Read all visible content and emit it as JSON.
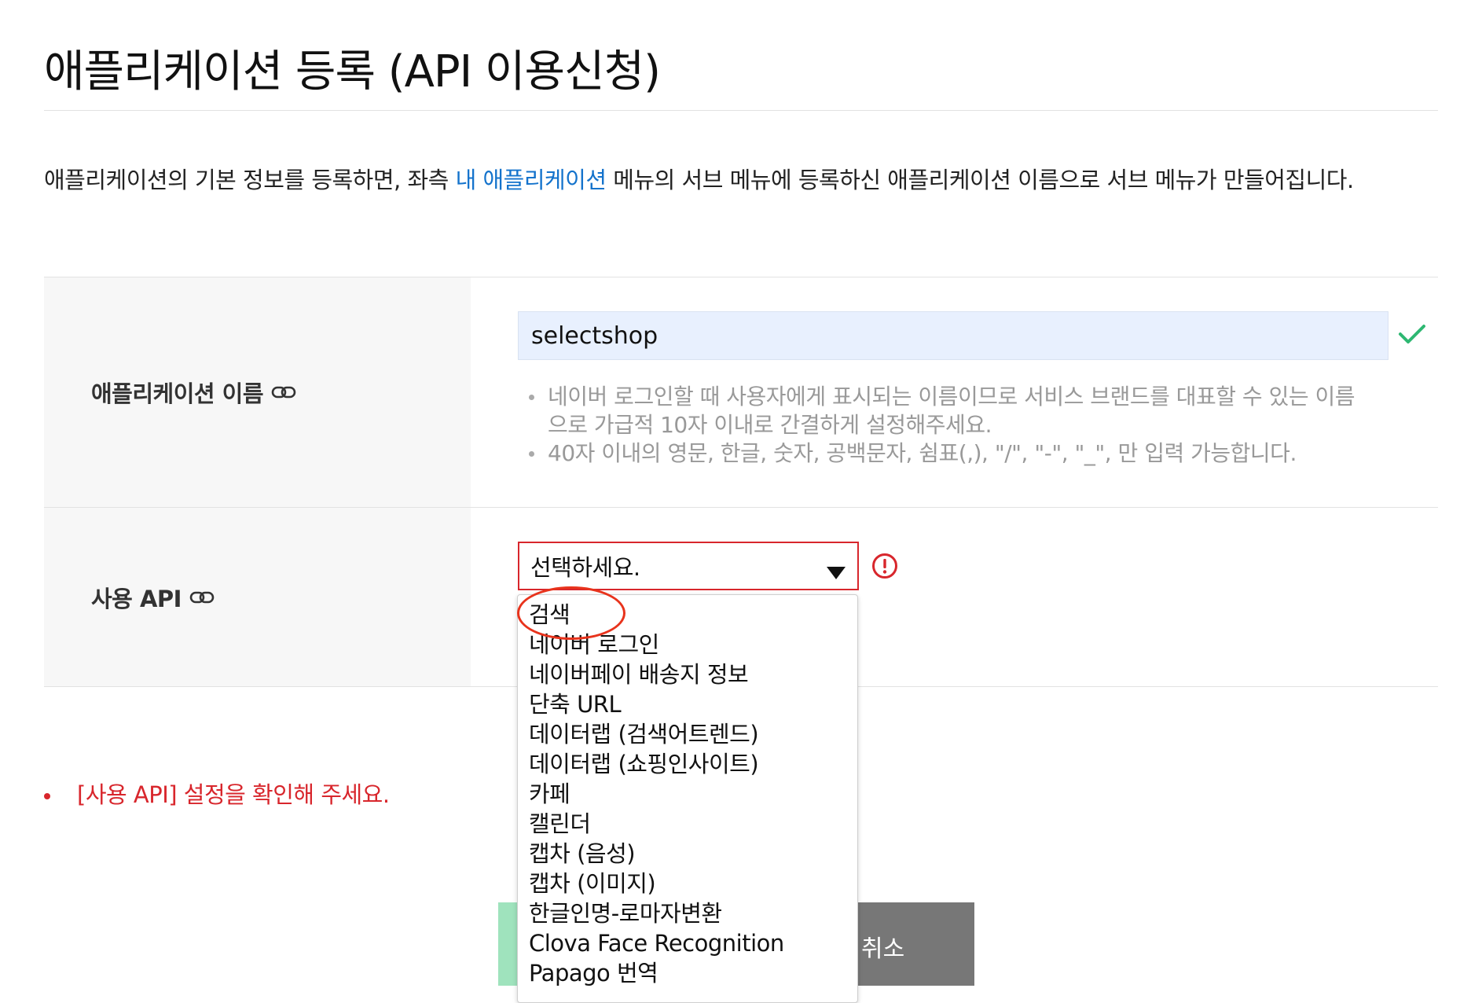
{
  "page": {
    "title": "애플리케이션 등록 (API 이용신청)"
  },
  "intro": {
    "before_link": "애플리케이션의 기본 정보를 등록하면, 좌측 ",
    "link_text": "내 애플리케이션",
    "after_link": " 메뉴의 서브 메뉴에 등록하신 애플리케이션 이름으로 서브 메뉴가 만들어집니다."
  },
  "form": {
    "app_name": {
      "label": "애플리케이션 이름",
      "value": "selectshop",
      "valid": true,
      "help": [
        "네이버 로그인할 때 사용자에게 표시되는 이름이므로 서비스 브랜드를 대표할 수 있는 이름으로 가급적 10자 이내로 간결하게 설정해주세요.",
        "40자 이내의 영문, 한글, 숫자, 공백문자, 쉼표(,), \"/\", \"-\", \"_\", 만 입력 가능합니다."
      ]
    },
    "api": {
      "label": "사용 API",
      "selected": "선택하세요.",
      "has_error": true,
      "options": [
        "검색",
        "네이버 로그인",
        "네이버페이 배송지 정보",
        "단축 URL",
        "데이터랩 (검색어트렌드)",
        "데이터랩 (쇼핑인사이트)",
        "카페",
        "캘린더",
        "캡차 (음성)",
        "캡차 (이미지)",
        "한글인명-로마자변환",
        "Clova Face Recognition",
        "Papago 번역"
      ]
    }
  },
  "error_message": "[사용 API] 설정을 확인해 주세요.",
  "buttons": {
    "cancel_label": "취소"
  },
  "colors": {
    "accent_link": "#1473cc",
    "error": "#d8262c",
    "valid_check": "#2eb872",
    "register_button": "#9fe3bd",
    "cancel_button": "#777777",
    "input_autofill": "#e8f0fe",
    "annotation_ring": "#e8331c"
  },
  "icons": {
    "label_link": "link-icon",
    "valid": "check-icon",
    "invalid": "error-circle-icon",
    "select_arrow": "caret-down-icon"
  }
}
